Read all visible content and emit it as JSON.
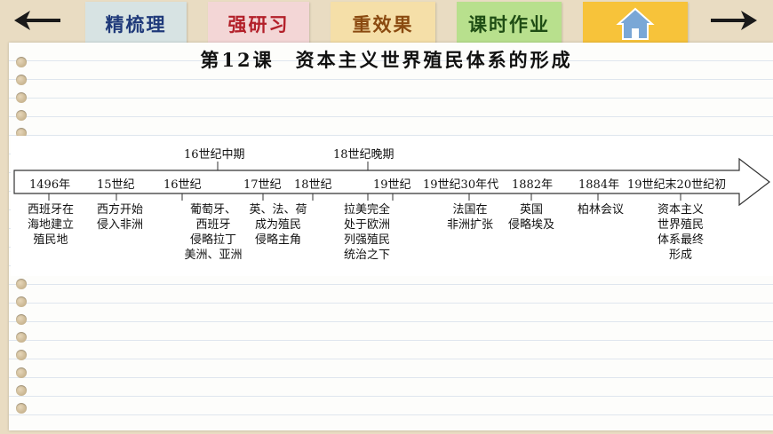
{
  "nav": {
    "back_icon": "left-arrow-icon",
    "forward_icon": "right-arrow-icon",
    "home_icon": "home-icon"
  },
  "tabs": [
    {
      "label": "精梳理",
      "bg": "#d7e3e3",
      "color": "#1f3a7a"
    },
    {
      "label": "强研习",
      "bg": "#f3d6d6",
      "color": "#b3202a"
    },
    {
      "label": "重效果",
      "bg": "#f5dfa8",
      "color": "#8a4a10"
    },
    {
      "label": "课时作业",
      "bg": "#b8e08d",
      "color": "#1f4d14"
    },
    {
      "label": "",
      "bg": "#f7c33a",
      "color": "#000000"
    }
  ],
  "title": "第12课　资本主义世界殖民体系的形成",
  "timeline": {
    "above": [
      {
        "text": "16世纪中期"
      },
      {
        "text": "18世纪晚期"
      }
    ],
    "dates": [
      {
        "text": "1496年"
      },
      {
        "text": "15世纪"
      },
      {
        "text": "16世纪"
      },
      {
        "text": "17世纪"
      },
      {
        "text": "18世纪"
      },
      {
        "text": "19世纪"
      },
      {
        "text": "19世纪30年代"
      },
      {
        "text": "1882年"
      },
      {
        "text": "1884年"
      },
      {
        "text": "19世纪末20世纪初"
      }
    ],
    "events": [
      {
        "text": "西班牙在\n海地建立\n殖民地"
      },
      {
        "text": "西方开始\n侵入非洲"
      },
      {
        "text": "葡萄牙、\n西班牙\n侵略拉丁\n美洲、亚洲"
      },
      {
        "text": "英、法、荷\n成为殖民\n侵略主角"
      },
      {
        "text": "拉美完全\n处于欧洲\n列强殖民\n统治之下"
      },
      {
        "text": "法国在\n非洲扩张"
      },
      {
        "text": "英国\n侵略埃及"
      },
      {
        "text": "柏林会议"
      },
      {
        "text": "资本主义\n世界殖民\n体系最终\n形成"
      }
    ]
  }
}
